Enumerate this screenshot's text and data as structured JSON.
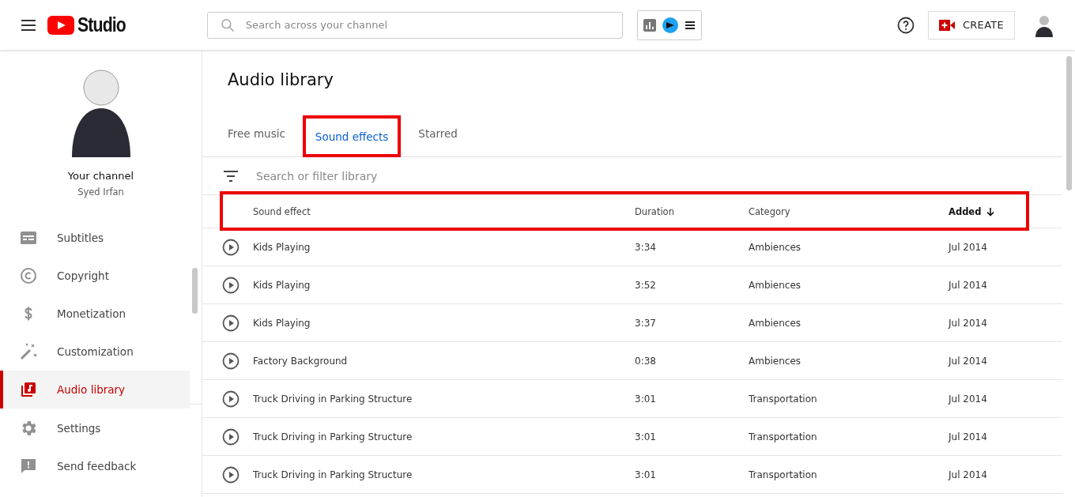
{
  "header": {
    "logo_text": "Studio",
    "search": {
      "placeholder": "Search across your channel"
    },
    "create_label": "CREATE"
  },
  "sidebar": {
    "channel_label": "Your channel",
    "channel_name": "Syed Irfan",
    "items": [
      {
        "label": "Subtitles",
        "selected": false
      },
      {
        "label": "Copyright",
        "selected": false
      },
      {
        "label": "Monetization",
        "selected": false
      },
      {
        "label": "Customization",
        "selected": false
      },
      {
        "label": "Audio library",
        "selected": true
      }
    ],
    "footer_items": [
      {
        "label": "Settings"
      },
      {
        "label": "Send feedback"
      }
    ]
  },
  "page": {
    "title": "Audio library",
    "tabs": [
      {
        "label": "Free music",
        "selected": false,
        "highlighted": false
      },
      {
        "label": "Sound effects",
        "selected": true,
        "highlighted": true
      },
      {
        "label": "Starred",
        "selected": false,
        "highlighted": false
      }
    ],
    "filter": {
      "placeholder": "Search or filter library"
    },
    "table": {
      "highlighted_header": true,
      "columns": [
        {
          "label": "Sound effect",
          "sorted": false
        },
        {
          "label": "Duration",
          "sorted": false
        },
        {
          "label": "Category",
          "sorted": false
        },
        {
          "label": "Added",
          "sorted": true
        }
      ],
      "rows": [
        [
          "Kids Playing",
          "3:34",
          "Ambiences",
          "Jul 2014"
        ],
        [
          "Kids Playing",
          "3:52",
          "Ambiences",
          "Jul 2014"
        ],
        [
          "Kids Playing",
          "3:37",
          "Ambiences",
          "Jul 2014"
        ],
        [
          "Factory Background",
          "0:38",
          "Ambiences",
          "Jul 2014"
        ],
        [
          "Truck Driving in Parking Structure",
          "3:01",
          "Transportation",
          "Jul 2014"
        ],
        [
          "Truck Driving in Parking Structure",
          "3:01",
          "Transportation",
          "Jul 2014"
        ],
        [
          "Truck Driving in Parking Structure",
          "3:01",
          "Transportation",
          "Jul 2014"
        ]
      ]
    }
  }
}
